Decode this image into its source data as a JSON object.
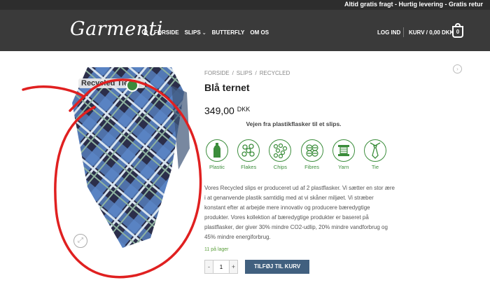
{
  "topbar": {
    "text": "Altid gratis fragt - Hurtig levering - Gratis retur"
  },
  "header": {
    "logo": "Garmenti",
    "nav": [
      {
        "label": "FORSIDE"
      },
      {
        "label": "SLIPS",
        "has_dropdown": true
      },
      {
        "label": "BUTTERFLY"
      },
      {
        "label": "OM OS"
      }
    ],
    "login": "LOG IND",
    "cart_label": "KURV / 0,00 DKK",
    "cart_count": "0"
  },
  "product": {
    "image_label": "Recycled Tie",
    "breadcrumb": [
      "FORSIDE",
      "SLIPS",
      "RECYCLED"
    ],
    "title": "Blå ternet",
    "price": "349,00",
    "currency": "DKK",
    "tagline": "Vejen fra plastikflasker til et slips.",
    "process_steps": [
      {
        "label": "Plastic",
        "icon": "bottle-icon"
      },
      {
        "label": "Flakes",
        "icon": "flakes-icon"
      },
      {
        "label": "Chips",
        "icon": "chips-icon"
      },
      {
        "label": "Fibres",
        "icon": "fibres-icon"
      },
      {
        "label": "Yarn",
        "icon": "yarn-icon"
      },
      {
        "label": "Tie",
        "icon": "tie-icon"
      }
    ],
    "description": "Vores Recycled slips er produceret ud af 2 plastflasker. Vi sætter en stor ære i at genanvende plastik samtidig med at vi skåner miljøet. Vi stræber konstant efter at arbejde mere innovativ og producere bæredygtige produkter. Vores kollektion af bæredygtige produkter er baseret på plastflasker, der giver 30% mindre CO2-udlip, 20% mindre vandforbrug og 45% mindre energiforbrug.",
    "stock": "11 på lager",
    "quantity": "1",
    "qty_minus": "-",
    "qty_plus": "+",
    "add_to_cart": "TILFØJ TIL KURV"
  },
  "colors": {
    "header_bg": "#3a3a3a",
    "accent_green": "#3b8d3b",
    "button_blue": "#41607f",
    "annotation_red": "#e02020"
  }
}
